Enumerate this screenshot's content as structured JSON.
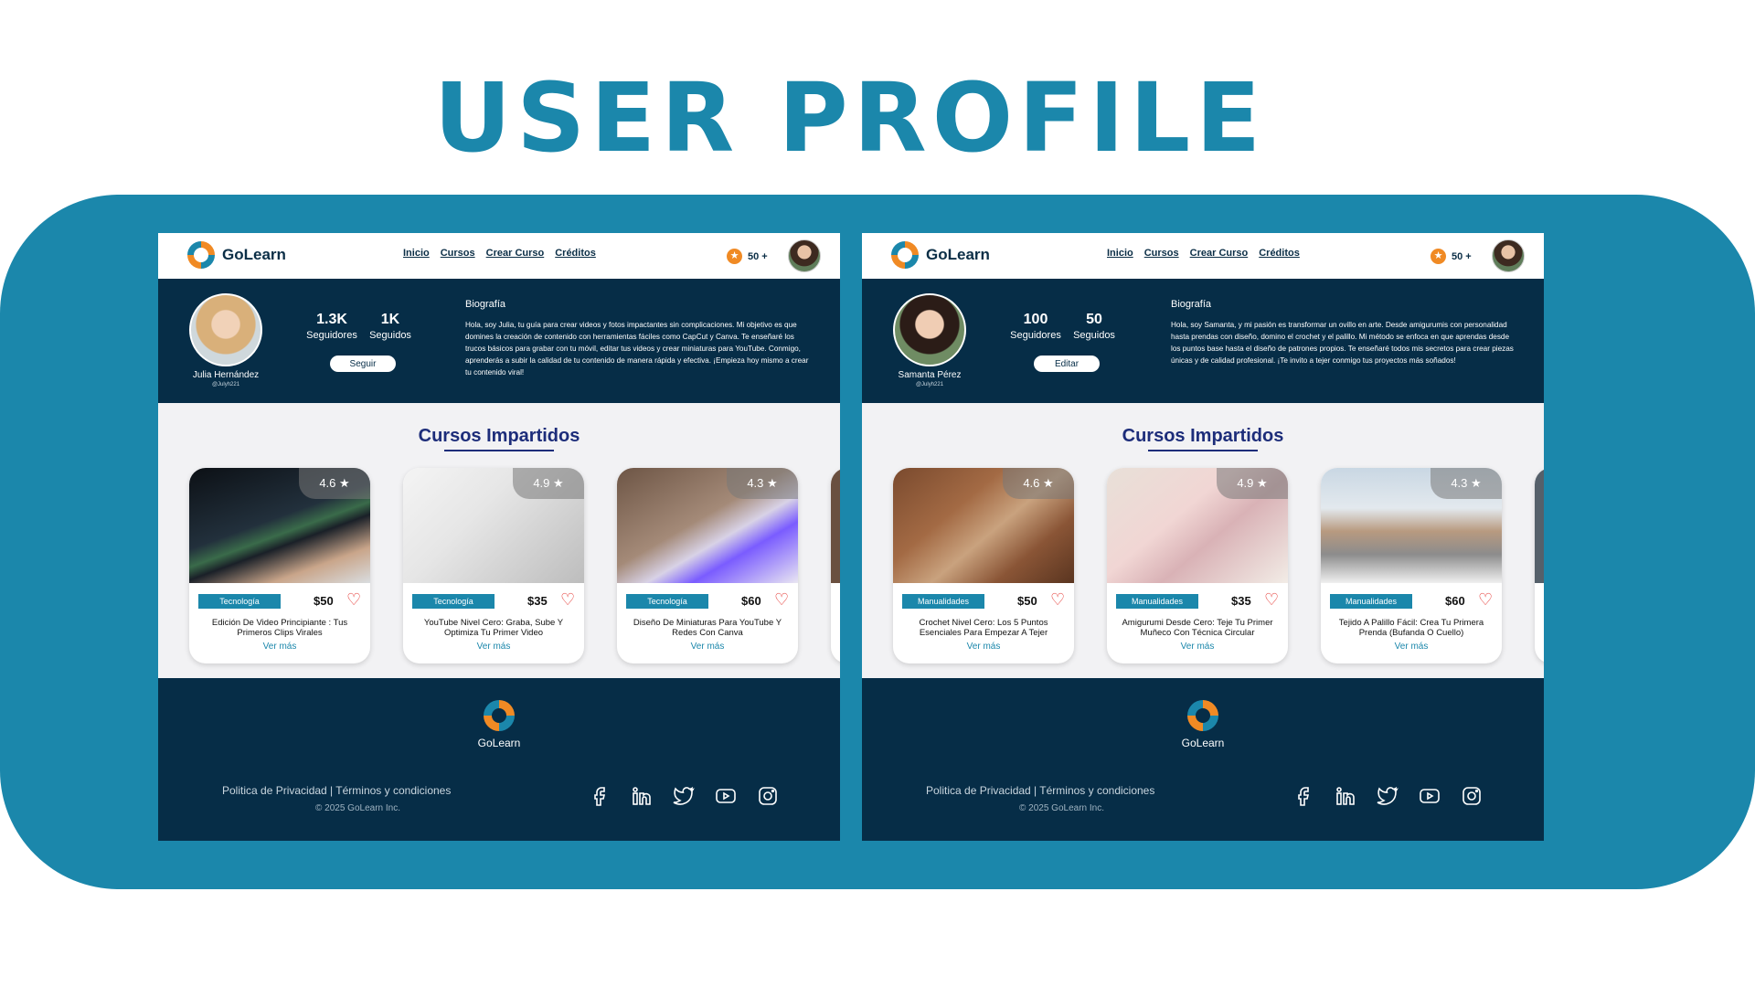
{
  "header": {
    "title": "USER PROFILE"
  },
  "colors": {
    "accent": "#1b87ab",
    "navy": "#062d47",
    "orange": "#f08a24",
    "heart": "#e53935"
  },
  "profiles": [
    {
      "nav": {
        "brand": "GoLearn",
        "links": [
          "Inicio",
          "Cursos",
          "Crear Curso",
          "Créditos"
        ],
        "credits": "50 +"
      },
      "user": {
        "name": "Julia Hernández",
        "handle": "@Julyh221",
        "followers": "1.3K",
        "followers_label": "Seguidores",
        "following": "1K",
        "following_label": "Seguidos",
        "action": "Seguir",
        "bio_title": "Biografía",
        "bio": "Hola, soy Julia, tu guía para crear videos y fotos impactantes sin complicaciones. Mi objetivo es que domines la creación de contenido con herramientas fáciles como CapCut y Canva. Te enseñaré los trucos básicos para grabar con tu móvil, editar tus videos y crear miniaturas para YouTube. Conmigo, aprenderás a subir la calidad de tu contenido de manera rápida y efectiva. ¡Empieza hoy mismo a crear tu contenido viral!"
      },
      "section_title": "Cursos Impartidos",
      "courses": [
        {
          "rating": "4.6",
          "tag": "Tecnología",
          "price": "$50",
          "title": "Edición De Video Principiante : Tus Primeros Clips Virales",
          "more": "Ver más"
        },
        {
          "rating": "4.9",
          "tag": "Tecnología",
          "price": "$35",
          "title": "YouTube Nivel Cero: Graba, Sube Y Optimiza Tu Primer Video",
          "more": "Ver más"
        },
        {
          "rating": "4.3",
          "tag": "Tecnología",
          "price": "$60",
          "title": "Diseño De Miniaturas Para YouTube Y Redes Con Canva",
          "more": "Ver más"
        }
      ],
      "footer": {
        "brand": "GoLearn",
        "links": "Politica de Privacidad | Términos y condiciones",
        "copyright": "© 2025 GoLearn Inc."
      },
      "socials": [
        "facebook-icon",
        "linkedin-icon",
        "twitter-icon",
        "youtube-icon",
        "instagram-icon"
      ]
    },
    {
      "nav": {
        "brand": "GoLearn",
        "links": [
          "Inicio",
          "Cursos",
          "Crear Curso",
          "Créditos"
        ],
        "credits": "50 +"
      },
      "user": {
        "name": "Samanta Pérez",
        "handle": "@Julyh221",
        "followers": "100",
        "followers_label": "Seguidores",
        "following": "50",
        "following_label": "Seguidos",
        "action": "Editar",
        "bio_title": "Biografía",
        "bio": "Hola, soy Samanta, y mi pasión es transformar un ovillo en arte. Desde amigurumis con personalidad hasta prendas con diseño, domino el crochet y el palillo. Mi método se enfoca en que aprendas desde los puntos base hasta el diseño de patrones propios. Te enseñaré todos mis secretos para crear piezas únicas y de calidad profesional. ¡Te invito a tejer conmigo tus proyectos más soñados!"
      },
      "section_title": "Cursos Impartidos",
      "courses": [
        {
          "rating": "4.6",
          "tag": "Manualidades",
          "price": "$50",
          "title": "Crochet Nivel Cero: Los 5 Puntos Esenciales Para Empezar A Tejer",
          "more": "Ver más"
        },
        {
          "rating": "4.9",
          "tag": "Manualidades",
          "price": "$35",
          "title": "Amigurumi Desde Cero: Teje Tu Primer Muñeco Con Técnica Circular",
          "more": "Ver más"
        },
        {
          "rating": "4.3",
          "tag": "Manualidades",
          "price": "$60",
          "title": "Tejido A Palillo Fácil: Crea Tu Primera Prenda (Bufanda O Cuello)",
          "more": "Ver más"
        }
      ],
      "footer": {
        "brand": "GoLearn",
        "links": "Politica de Privacidad | Términos y condiciones",
        "copyright": "© 2025 GoLearn Inc."
      },
      "socials": [
        "facebook-icon",
        "linkedin-icon",
        "twitter-icon",
        "youtube-icon",
        "instagram-icon"
      ]
    }
  ]
}
